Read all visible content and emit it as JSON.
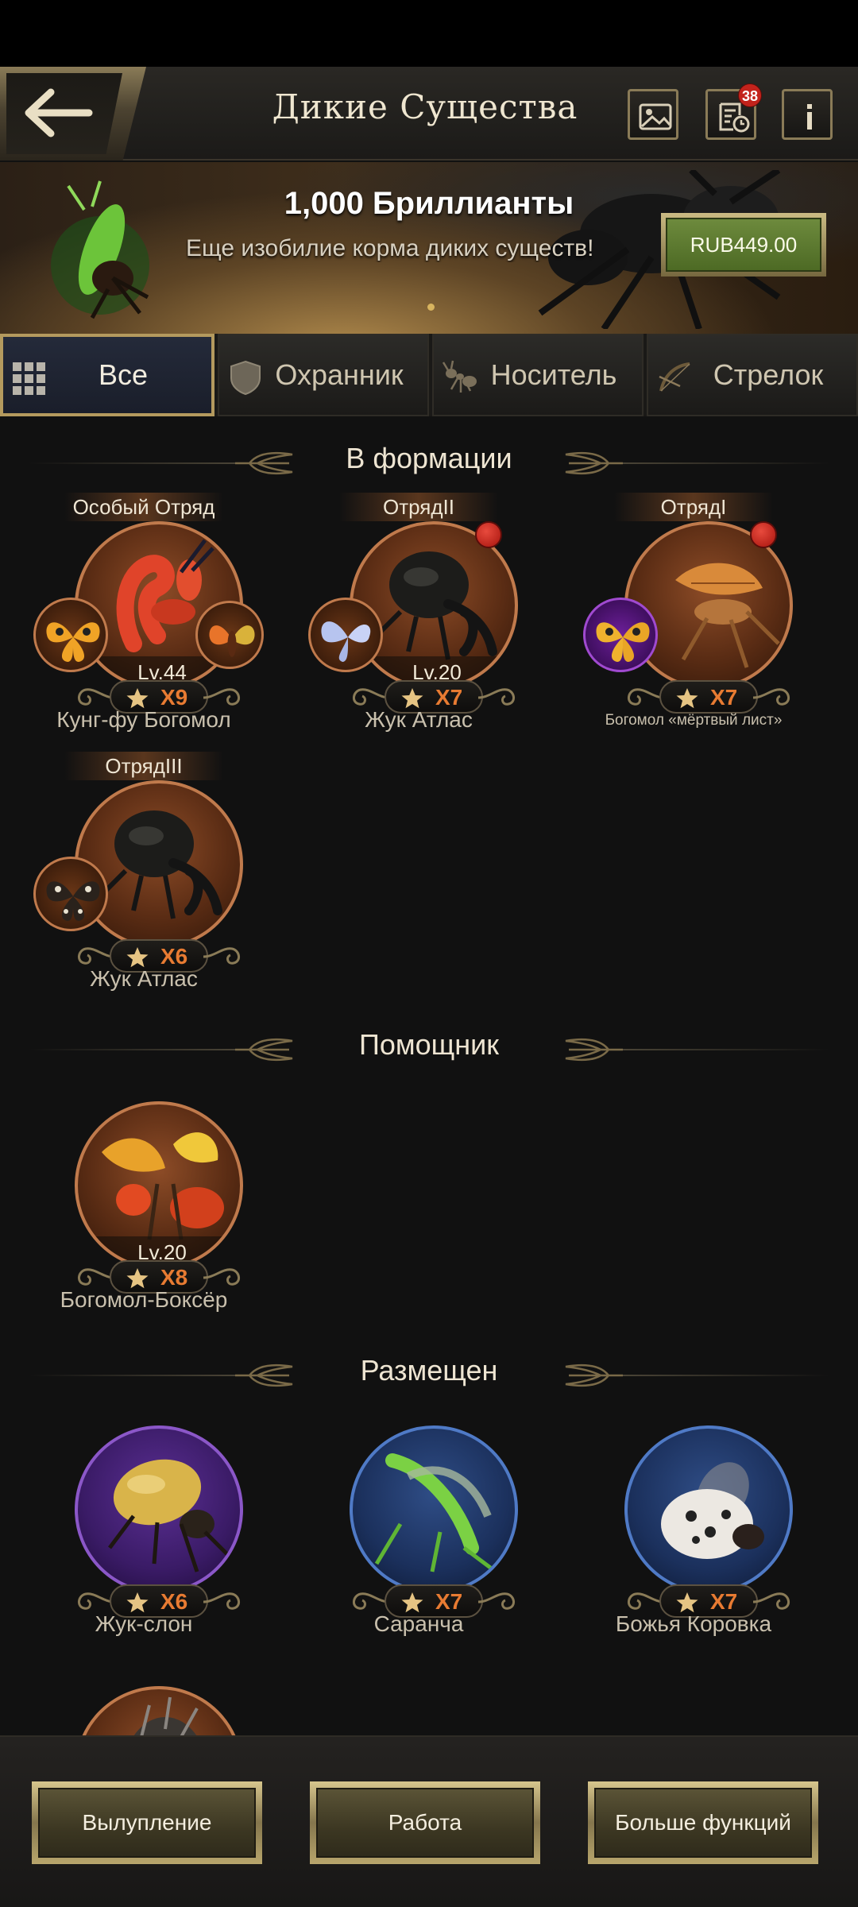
{
  "header": {
    "title": "Дикие Существа",
    "badge_count": "38"
  },
  "banner": {
    "title": "1,000 Бриллианты",
    "subtitle": "Еще изобилие корма диких существ!",
    "price": "RUB449.00"
  },
  "tabs": [
    {
      "label": "Все",
      "icon": "grid-icon",
      "active": true
    },
    {
      "label": "Охранник",
      "icon": "shield-icon",
      "active": false
    },
    {
      "label": "Носитель",
      "icon": "ant-icon",
      "active": false
    },
    {
      "label": "Стрелок",
      "icon": "bow-icon",
      "active": false
    }
  ],
  "sections": {
    "formation": {
      "title": "В формации",
      "cards": [
        {
          "squad": "Особый Отряд",
          "level": "Lv.44",
          "stars": "X9",
          "name": "Кунг-фу Богомол"
        },
        {
          "squad": "ОтрядII",
          "level": "Lv.20",
          "stars": "X7",
          "name": "Жук Атлас"
        },
        {
          "squad": "ОтрядI",
          "level": "",
          "stars": "X7",
          "name": "Богомол «мёртвый лист»"
        },
        {
          "squad": "ОтрядIII",
          "level": "",
          "stars": "X6",
          "name": "Жук Атлас"
        }
      ]
    },
    "helper": {
      "title": "Помощник",
      "cards": [
        {
          "level": "Lv.20",
          "stars": "X8",
          "name": "Богомол-Боксёр"
        }
      ]
    },
    "placed": {
      "title": "Размещен",
      "cards": [
        {
          "stars": "X6",
          "name": "Жук-слон"
        },
        {
          "stars": "X7",
          "name": "Саранча"
        },
        {
          "stars": "X7",
          "name": "Божья Коровка"
        }
      ]
    }
  },
  "bottom_buttons": [
    "Вылупление",
    "Работа",
    "Больше функций"
  ],
  "colors": {
    "accent_gold": "#b49a5e",
    "star_orange": "#e87b32",
    "price_green": "#5d7a2f",
    "badge_red": "#c3231c"
  }
}
